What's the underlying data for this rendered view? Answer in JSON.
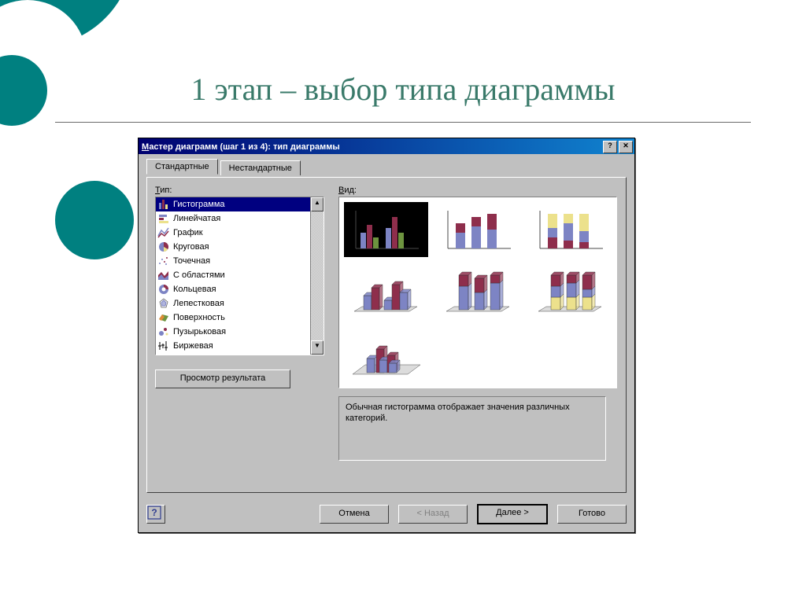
{
  "slide": {
    "title": "1 этап – выбор типа диаграммы"
  },
  "dialog": {
    "title_prefix": "М",
    "title_rest": "астер диаграмм (шаг 1 из 4): тип диаграммы",
    "help_button_glyph": "?",
    "close_button_glyph": "✕",
    "tabs": {
      "standard": "Стандартные",
      "custom": "Нестандартные"
    },
    "labels": {
      "type_u": "Т",
      "type_rest": "ип:",
      "view_u": "В",
      "view_rest": "ид:"
    },
    "type_list": [
      {
        "id": "bar",
        "label": "Гистограмма",
        "selected": true
      },
      {
        "id": "hbar",
        "label": "Линейчатая",
        "selected": false
      },
      {
        "id": "line",
        "label": "График",
        "selected": false
      },
      {
        "id": "pie",
        "label": "Круговая",
        "selected": false
      },
      {
        "id": "scatter",
        "label": "Точечная",
        "selected": false
      },
      {
        "id": "area",
        "label": "С областями",
        "selected": false
      },
      {
        "id": "donut",
        "label": "Кольцевая",
        "selected": false
      },
      {
        "id": "radar",
        "label": "Лепестковая",
        "selected": false
      },
      {
        "id": "surface",
        "label": "Поверхность",
        "selected": false
      },
      {
        "id": "bubble",
        "label": "Пузырьковая",
        "selected": false
      },
      {
        "id": "stock",
        "label": "Биржевая",
        "selected": false
      }
    ],
    "view_count": 7,
    "description": "Обычная гистограмма отображает значения различных категорий.",
    "buttons": {
      "preview": "Просмотр результата",
      "cancel": "Отмена",
      "back": "< Назад",
      "next": "Далее >",
      "finish": "Готово"
    },
    "scrollbar": {
      "up": "▲",
      "down": "▼"
    },
    "help_footer_glyph": "?"
  },
  "colors": {
    "accent_teal": "#008080",
    "win_blue": "#000080",
    "win_bg": "#c0c0c0",
    "chart_blue": "#7d84c4",
    "chart_red": "#8e2e4c",
    "chart_yellow": "#ece18c",
    "chart_green": "#6d943f",
    "chart_orange": "#e08a35"
  }
}
